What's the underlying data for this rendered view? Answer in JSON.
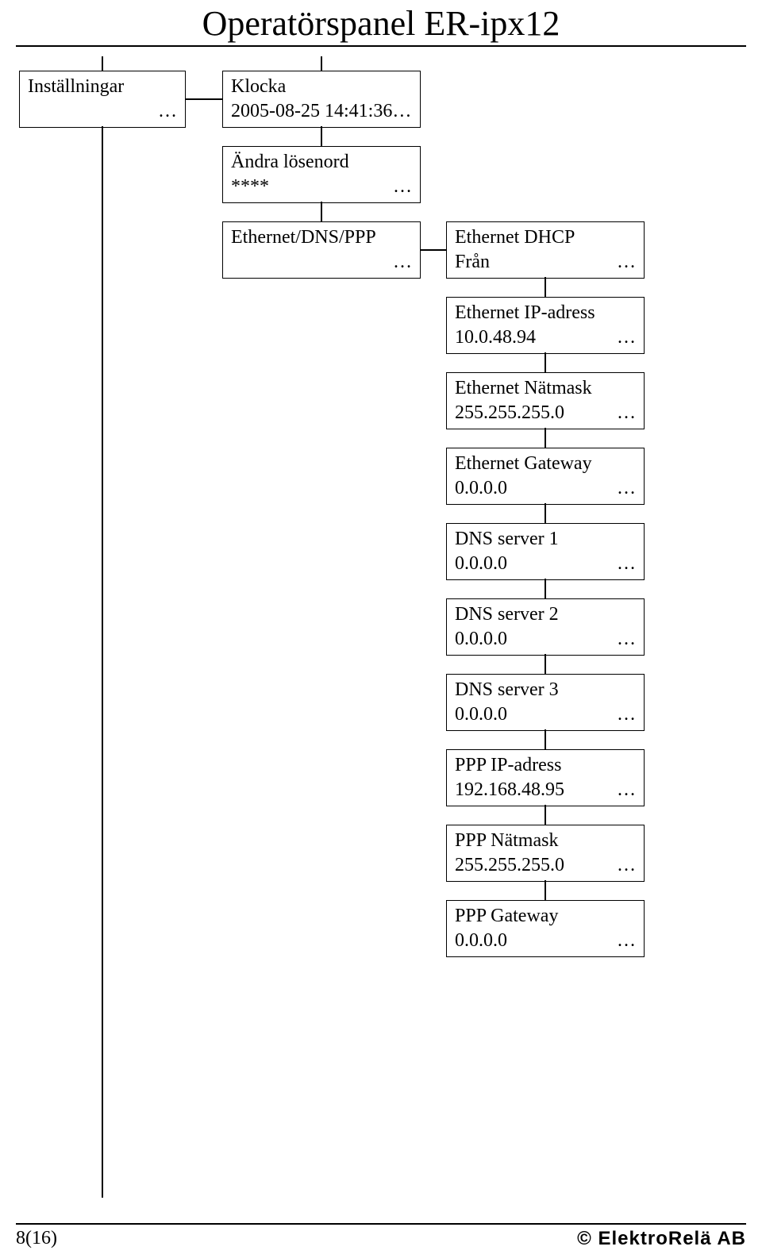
{
  "title": "Operatörspanel ER-ipx12",
  "ellipsis": "…",
  "root": {
    "label": "Inställningar"
  },
  "col2": [
    {
      "line1": "Klocka",
      "line2": "2005-08-25 14:41:36…"
    },
    {
      "line1": "Ändra lösenord",
      "line2": "****"
    },
    {
      "line1": "Ethernet/DNS/PPP",
      "line2": ""
    }
  ],
  "col3": [
    {
      "line1": "Ethernet DHCP",
      "line2": "Från"
    },
    {
      "line1": "Ethernet IP-adress",
      "line2": "10.0.48.94"
    },
    {
      "line1": "Ethernet Nätmask",
      "line2": "255.255.255.0"
    },
    {
      "line1": "Ethernet Gateway",
      "line2": "0.0.0.0"
    },
    {
      "line1": "DNS server 1",
      "line2": "0.0.0.0"
    },
    {
      "line1": "DNS server 2",
      "line2": "0.0.0.0"
    },
    {
      "line1": "DNS server 3",
      "line2": "0.0.0.0"
    },
    {
      "line1": "PPP IP-adress",
      "line2": "192.168.48.95"
    },
    {
      "line1": "PPP Nätmask",
      "line2": "255.255.255.0"
    },
    {
      "line1": "PPP Gateway",
      "line2": "0.0.0.0"
    }
  ],
  "footer": {
    "left": "8(16)",
    "right": "© ElektroRelä AB"
  }
}
